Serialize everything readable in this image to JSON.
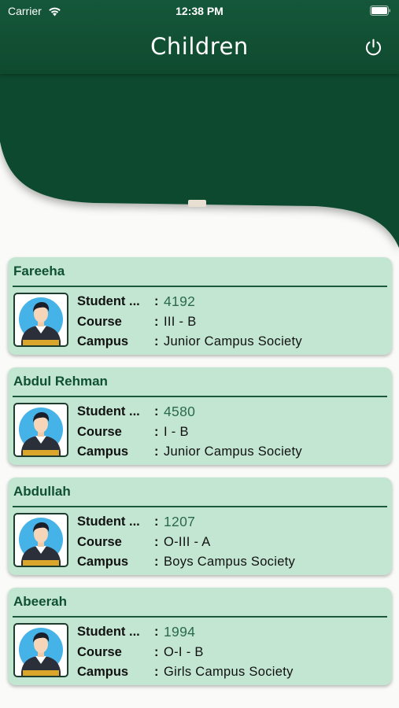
{
  "status_bar": {
    "carrier": "Carrier",
    "time": "12:38 PM"
  },
  "header": {
    "title": "Children",
    "power_icon": "power-icon"
  },
  "colors": {
    "header_green": "#15573a",
    "card_bg": "#c2e6d2",
    "name_green": "#0f5032",
    "id_green": "#2a6a4a"
  },
  "labels": {
    "student": "Student ...",
    "course": "Course",
    "campus": "Campus",
    "colon": ":"
  },
  "children": [
    {
      "name": "Fareeha",
      "student_id": "4192",
      "course": "III - B",
      "campus": "Junior Campus Society"
    },
    {
      "name": "Abdul Rehman",
      "student_id": "4580",
      "course": "I - B",
      "campus": "Junior Campus Society"
    },
    {
      "name": "Abdullah",
      "student_id": "1207",
      "course": "O-III - A",
      "campus": "Boys Campus Society"
    },
    {
      "name": "Abeerah",
      "student_id": "1994",
      "course": "O-I - B",
      "campus": "Girls Campus Society"
    }
  ]
}
